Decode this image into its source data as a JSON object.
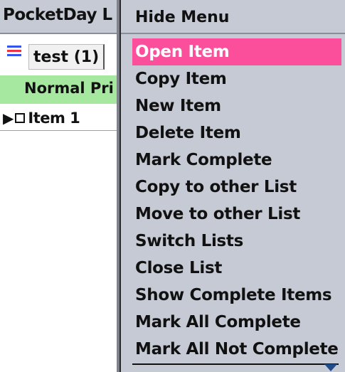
{
  "app": {
    "title": "PocketDay L",
    "list_selector": {
      "label": "test (1)"
    },
    "priority_header": "Normal Pri",
    "items": [
      {
        "label": "Item 1"
      }
    ],
    "icons": {
      "list_icon": "list-lines-icon",
      "expand_icon": "triangle-right-icon",
      "checkbox_icon": "checkbox-empty-icon"
    }
  },
  "menu": {
    "header": "Hide Menu",
    "items": [
      {
        "label": "Open Item",
        "selected": true
      },
      {
        "label": "Copy Item"
      },
      {
        "label": "New Item"
      },
      {
        "label": "Delete Item"
      },
      {
        "label": "Mark Complete"
      },
      {
        "label": "Copy to other List"
      },
      {
        "label": "Move to other List"
      },
      {
        "label": "Switch Lists"
      },
      {
        "label": "Close List"
      },
      {
        "label": "Show Complete Items"
      },
      {
        "label": "Mark All Complete"
      },
      {
        "label": "Mark All Not Complete"
      }
    ],
    "scroll_icon": "scroll-down-arrow-icon"
  },
  "colors": {
    "menu_background": "#c6cad4",
    "selection_highlight": "#fb4f9c",
    "priority_row": "#a7e8a0",
    "scroll_arrow": "#1f4c8a"
  }
}
